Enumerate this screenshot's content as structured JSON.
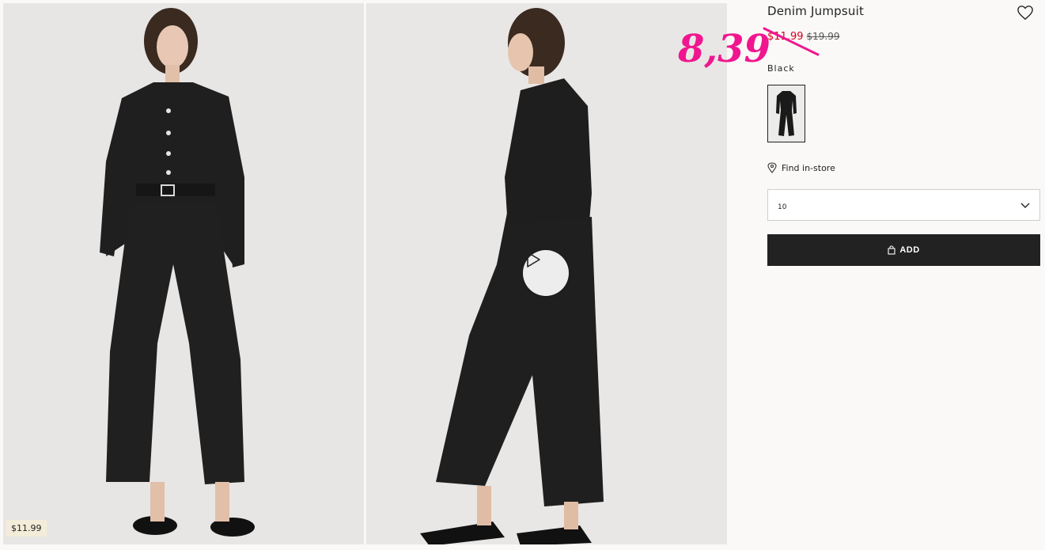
{
  "product": {
    "title": "Denim Jumpsuit",
    "sale_price": "$11.99",
    "original_price": "$19.99",
    "color_label": "Black",
    "find_in_store": "Find in-store",
    "selected_size": "10",
    "add_label": "ADD"
  },
  "gallery": {
    "price_tag": "$11.99"
  },
  "annotation": {
    "handwritten_price": "8,39"
  },
  "colors": {
    "sale_red": "#d6001c",
    "annotation_pink": "#f0168f",
    "button_dark": "#222222",
    "page_bg": "#faf9f8"
  },
  "icons": [
    "play-icon",
    "heart-icon",
    "location-pin-icon",
    "chevron-down-icon",
    "shopping-bag-icon"
  ]
}
